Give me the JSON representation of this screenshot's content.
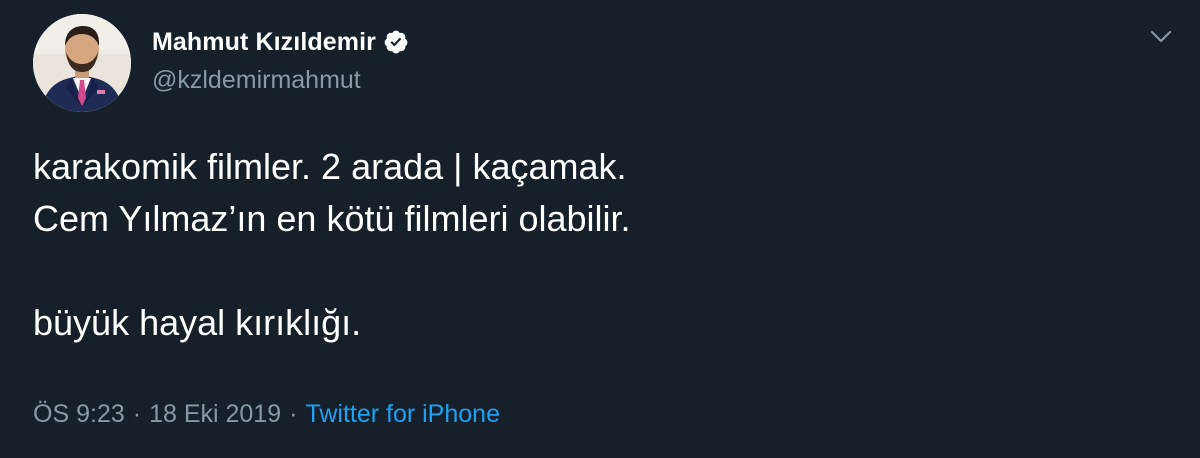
{
  "author": {
    "display_name": "Mahmut Kızıldemir",
    "handle": "@kzldemirmahmut",
    "verified": true
  },
  "tweet": {
    "lines": [
      "karakomik filmler. 2 arada | kaçamak.",
      "Cem Yılmaz’ın en kötü filmleri olabilir.",
      "",
      "büyük hayal kırıklığı."
    ]
  },
  "meta": {
    "time": "ÖS 9:23",
    "separator": "·",
    "date": "18 Eki 2019",
    "source": "Twitter for iPhone"
  },
  "colors": {
    "background": "#15202b",
    "text": "#ffffff",
    "secondary_text": "#8899a6",
    "accent": "#1da1f2"
  },
  "icons": {
    "verified": "verified-badge-icon",
    "more": "chevron-down-icon"
  }
}
